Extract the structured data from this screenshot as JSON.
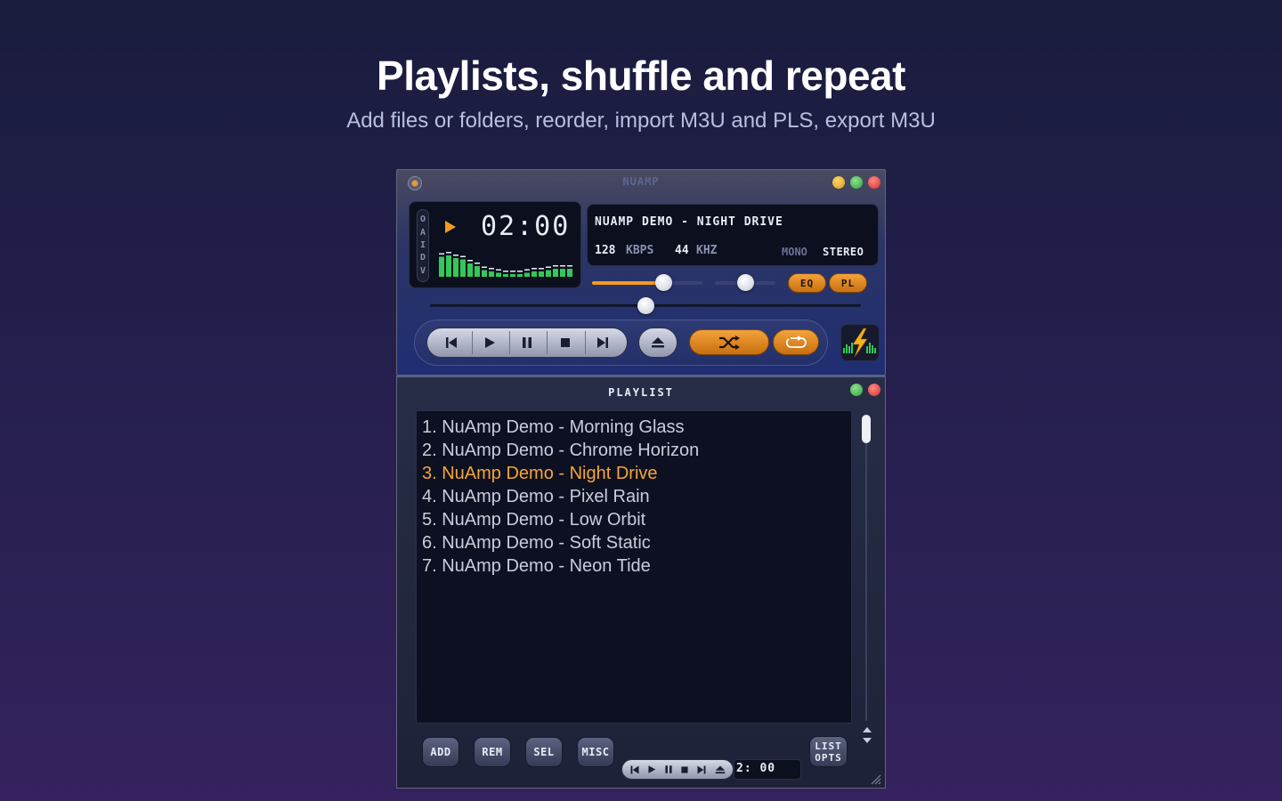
{
  "hero": {
    "title": "Playlists, shuffle and repeat",
    "subtitle": "Add files or folders, reorder, import M3U and PLS, export M3U"
  },
  "player": {
    "window_title": "NUAMP",
    "clutterbar": [
      "O",
      "A",
      "I",
      "D",
      "V"
    ],
    "state_icon": "play-icon",
    "time": "02:00",
    "track_title": "NUAMP DEMO - NIGHT DRIVE",
    "bitrate": "128",
    "bitrate_unit": "KBPS",
    "samplerate": "44",
    "samplerate_unit": "KHZ",
    "mono_label": "MONO",
    "stereo_label": "STEREO",
    "volume_level": 0.65,
    "balance_level": 0.5,
    "seek_position": 0.5,
    "eq_label": "EQ",
    "pl_label": "PL",
    "transport_icons": [
      "previous-icon",
      "play-icon",
      "pause-icon",
      "stop-icon",
      "next-icon"
    ],
    "eject_icon": "eject-icon",
    "shuffle_icon": "shuffle-icon",
    "repeat_icon": "repeat-icon",
    "logo_icon": "lightning-logo-icon",
    "spectrum_levels": [
      0.75,
      0.8,
      0.7,
      0.65,
      0.5,
      0.4,
      0.25,
      0.2,
      0.15,
      0.1,
      0.1,
      0.1,
      0.15,
      0.2,
      0.2,
      0.25,
      0.3,
      0.3,
      0.3
    ],
    "colors": {
      "accent": "#f39a1e",
      "spectrum": "#34c759",
      "display_bg": "#0c0f1d"
    }
  },
  "playlist": {
    "title": "PLAYLIST",
    "items": [
      "1. NuAmp Demo - Morning Glass",
      "2. NuAmp Demo - Chrome Horizon",
      "3. NuAmp Demo - Night Drive",
      "4. NuAmp Demo - Pixel Rain",
      "5. NuAmp Demo - Low Orbit",
      "6. NuAmp Demo - Soft Static",
      "7. NuAmp Demo - Neon Tide"
    ],
    "current_index": 2,
    "current_color": "#f5a536",
    "buttons": {
      "add": "ADD",
      "rem": "REM",
      "sel": "SEL",
      "misc": "MISC",
      "list_opts_line1": "LIST",
      "list_opts_line2": "OPTS"
    },
    "mini_time": "2: 00",
    "mini_transport_icons": [
      "previous-icon",
      "play-icon",
      "pause-icon",
      "stop-icon",
      "next-icon",
      "eject-icon"
    ]
  }
}
